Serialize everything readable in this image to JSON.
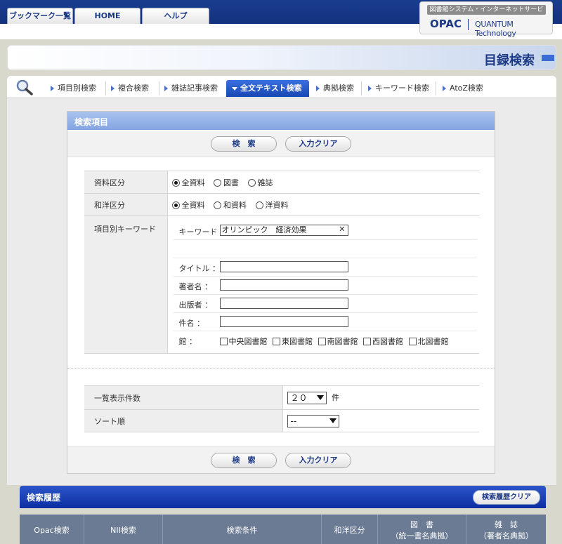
{
  "top_tabs": [
    "ブックマーク一覧",
    "HOME",
    "ヘルプ"
  ],
  "brand": {
    "service": "図書館システム・インターネットサービス",
    "opac": "OPAC",
    "partner": "QUANTUM Technology"
  },
  "page_title": "目録検索",
  "search_tabs": [
    "項目別検索",
    "複合検索",
    "雑誌記事検索",
    "全文テキスト検索",
    "典拠検索",
    "キーワード検索",
    "AtoZ検索"
  ],
  "active_search_tab": "全文テキスト検索",
  "form": {
    "header": "検索項目",
    "search_button": "検　索",
    "clear_button": "入力クリア",
    "material_type": {
      "label": "資料区分",
      "options": [
        "全資料",
        "図書",
        "雑誌"
      ],
      "selected": "全資料"
    },
    "language": {
      "label": "和洋区分",
      "options": [
        "全資料",
        "和資料",
        "洋資料"
      ],
      "selected": "全資料"
    },
    "keyword_section": {
      "label": "項目別キーワード",
      "keyword": {
        "label": "キーワード",
        "value": "オリンピック　経済効果"
      },
      "title": {
        "label": "タイトル ：",
        "value": ""
      },
      "author": {
        "label": "著者名 ：",
        "value": ""
      },
      "publisher": {
        "label": "出版者 ：",
        "value": ""
      },
      "subject": {
        "label": "件名 ：",
        "value": ""
      },
      "library": {
        "label": "館 ：",
        "options": [
          "中央図書館",
          "東図書館",
          "南図書館",
          "西図書館",
          "北図書館"
        ]
      }
    },
    "display_count": {
      "label": "一覧表示件数",
      "value": "２０",
      "unit": "件"
    },
    "sort_order": {
      "label": "ソート順",
      "value": "--"
    }
  },
  "history": {
    "title": "検索履歴",
    "clear_button": "検索履歴クリア",
    "columns": [
      {
        "line1": "Opac検索",
        "line2": ""
      },
      {
        "line1": "NII検索",
        "line2": ""
      },
      {
        "line1": "検索条件",
        "line2": ""
      },
      {
        "line1": "和洋区分",
        "line2": ""
      },
      {
        "line1": "図　書",
        "line2": "（統一書名典拠）"
      },
      {
        "line1": "雑　誌",
        "line2": "（著者名典拠）"
      }
    ]
  }
}
